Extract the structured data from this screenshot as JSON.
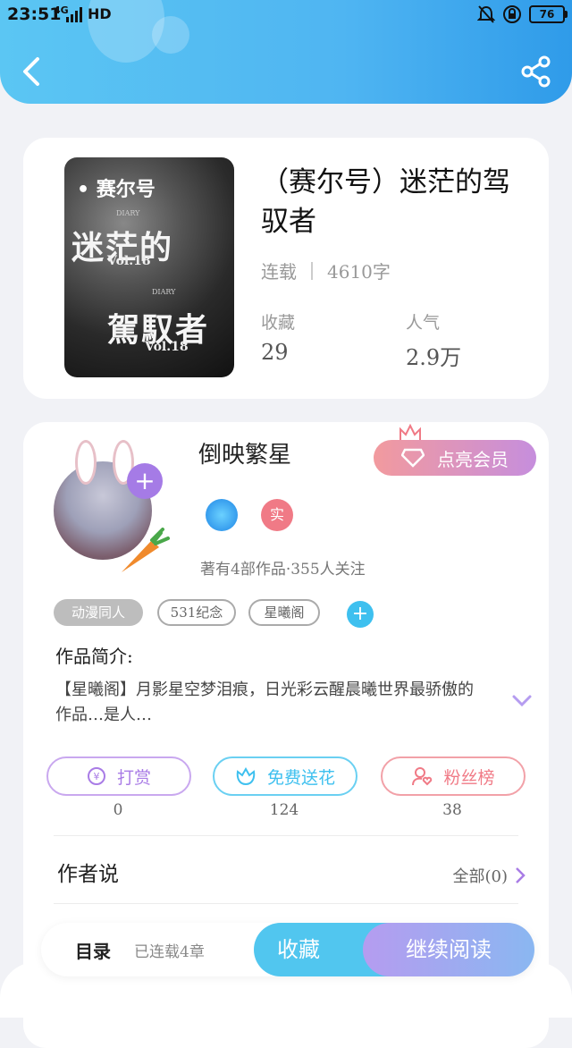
{
  "status": {
    "time": "23:51",
    "network": "4G",
    "hd": "HD",
    "battery": "76"
  },
  "book": {
    "title": "（赛尔号）迷茫的驾驭者",
    "status": "连载",
    "word_count": "4610字",
    "cover": {
      "brand": "赛尔号",
      "line1": "迷茫的",
      "line2": "駕馭者",
      "vol": "Vol.18",
      "diary": "DIARY"
    },
    "stats": [
      {
        "label": "收藏",
        "value": "29"
      },
      {
        "label": "人气",
        "value": "2.9万"
      }
    ]
  },
  "author": {
    "name": "倒映繁星",
    "member_button": "点亮会员",
    "badge_real": "实",
    "works_info": "著有4部作品·355人关注",
    "tags": [
      "动漫同人",
      "531纪念",
      "星曦阁"
    ]
  },
  "intro": {
    "heading": "作品简介:",
    "text": "【星曦阁】月影星空梦泪痕，日光彩云醒晨曦世界最骄傲的作品…是人…"
  },
  "actions": [
    {
      "label": "打赏",
      "count": "0",
      "color": "#a97ce6"
    },
    {
      "label": "免费送花",
      "count": "124",
      "color": "#3ec0ef"
    },
    {
      "label": "粉丝榜",
      "count": "38",
      "color": "#f07a86"
    }
  ],
  "author_says": {
    "heading": "作者说",
    "all": "全部(0)"
  },
  "bottom": {
    "toc": "目录",
    "chapters": "已连载4章",
    "favorite": "收藏",
    "continue": "继续阅读"
  }
}
